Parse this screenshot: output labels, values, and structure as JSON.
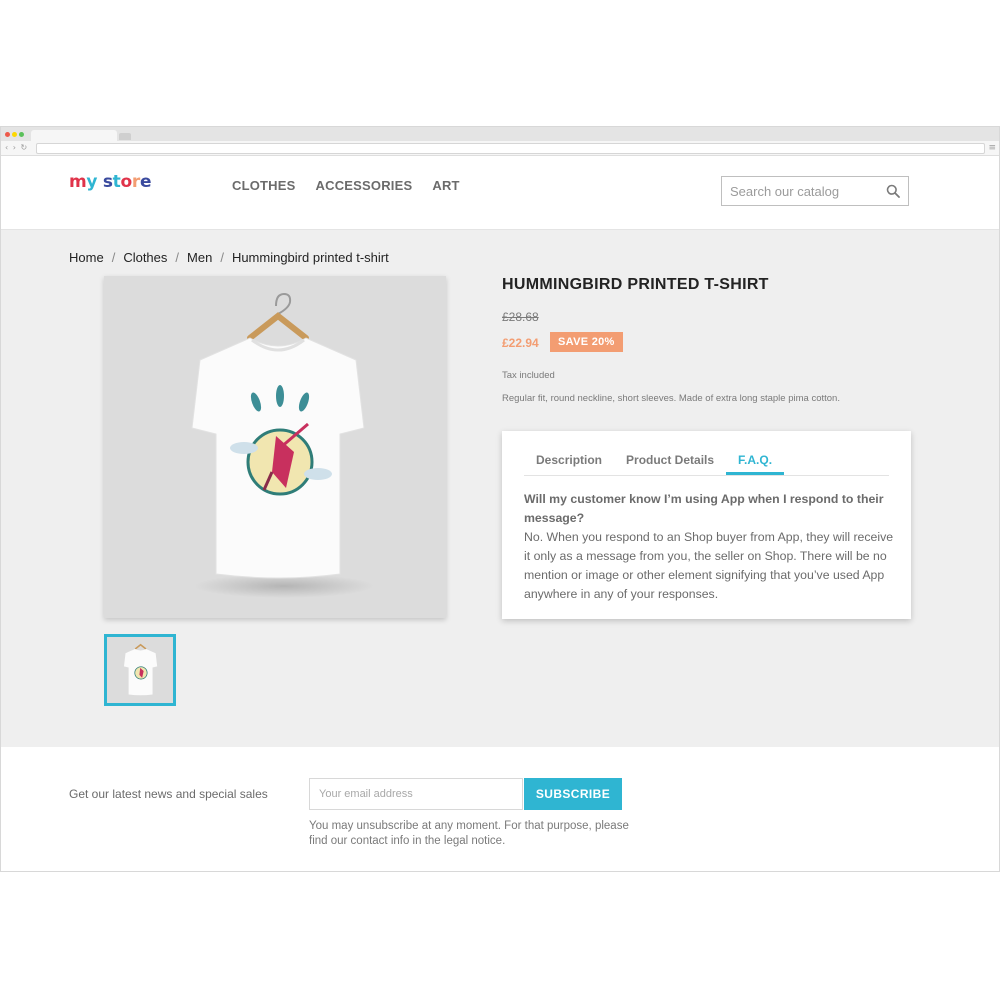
{
  "browser": {
    "traffic_lights": [
      "#ed594a",
      "#fdd800",
      "#5ac05a"
    ],
    "nav_glyphs": "‹ › ↻",
    "menu_glyph": "≡"
  },
  "store": {
    "logo_letters": [
      {
        "ch": "m",
        "color": "#e0334a"
      },
      {
        "ch": "y",
        "color": "#2fb5d2"
      },
      {
        "ch": " ",
        "color": "#232323"
      },
      {
        "ch": "s",
        "color": "#3a4a9e"
      },
      {
        "ch": "t",
        "color": "#2fb5d2"
      },
      {
        "ch": "o",
        "color": "#e0334a"
      },
      {
        "ch": "r",
        "color": "#f39d72"
      },
      {
        "ch": "e",
        "color": "#3a4a9e"
      }
    ],
    "nav": [
      "CLOTHES",
      "ACCESSORIES",
      "ART"
    ],
    "search_placeholder": "Search our catalog",
    "search_icon": "search-icon"
  },
  "breadcrumb": [
    "Home",
    "Clothes",
    "Men",
    "Hummingbird printed t-shirt"
  ],
  "product": {
    "title": "HUMMINGBIRD PRINTED T-SHIRT",
    "old_price": "£28.68",
    "price": "£22.94",
    "discount_label": "SAVE 20%",
    "tax_note": "Tax included",
    "short_description": "Regular fit, round neckline, short sleeves. Made of extra long staple pima cotton.",
    "tabs": [
      "Description",
      "Product Details",
      "F.A.Q."
    ],
    "active_tab": "F.A.Q.",
    "faq_question": "Will my customer know I’m using App when I respond to their message?",
    "faq_answer": "No.  When you respond to an Shop buyer from App, they will receive it only as a message from you, the seller on Shop. There will be no mention or image or other element signifying that you’ve used App anywhere in any of your responses."
  },
  "newsletter": {
    "label": "Get our latest news and special sales",
    "email_placeholder": "Your email address",
    "button": "SUBSCRIBE",
    "note": "You may unsubscribe at any moment. For that purpose, please find our contact info in the legal notice."
  },
  "colors": {
    "accent": "#2fb5d2",
    "discount": "#f39d72"
  }
}
